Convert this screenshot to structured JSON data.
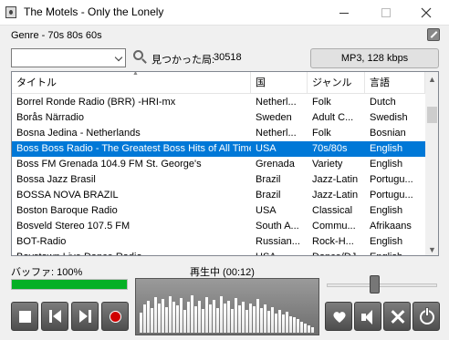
{
  "window": {
    "title": "The Motels - Only the Lonely"
  },
  "genre": {
    "label": "Genre - 70s 80s 60s"
  },
  "search": {
    "dropdown_value": "",
    "found_label": "見つかった局:",
    "found_count": "30518"
  },
  "format_button": {
    "label": "MP3, 128 kbps"
  },
  "table": {
    "columns": [
      "タイトル",
      "国",
      "ジャンル",
      "言語"
    ],
    "rows": [
      {
        "title": "Borrel Ronde Radio (BRR) -HRI-mx",
        "country": "Netherl...",
        "genre": "Folk",
        "language": "Dutch"
      },
      {
        "title": "Borås Närradio",
        "country": "Sweden",
        "genre": "Adult C...",
        "language": "Swedish"
      },
      {
        "title": "Bosna Jedina - Netherlands",
        "country": "Netherl...",
        "genre": "Folk",
        "language": "Bosnian"
      },
      {
        "title": "Boss Boss Radio - The Greatest Boss Hits of All Time",
        "country": "USA",
        "genre": "70s/80s",
        "language": "English",
        "selected": true
      },
      {
        "title": "Boss FM Grenada 104.9 FM St. George's",
        "country": "Grenada",
        "genre": "Variety",
        "language": "English"
      },
      {
        "title": "Bossa Jazz Brasil",
        "country": "Brazil",
        "genre": "Jazz-Latin",
        "language": "Portugu..."
      },
      {
        "title": "BOSSA NOVA BRAZIL",
        "country": "Brazil",
        "genre": "Jazz-Latin",
        "language": "Portugu..."
      },
      {
        "title": "Boston Baroque Radio",
        "country": "USA",
        "genre": "Classical",
        "language": "English"
      },
      {
        "title": "Bosveld Stereo 107.5 FM",
        "country": "South A...",
        "genre": "Commu...",
        "language": "Afrikaans"
      },
      {
        "title": "BOT-Radio",
        "country": "Russian...",
        "genre": "Rock-H...",
        "language": "English"
      },
      {
        "title": "Boystown Live Dance Radio",
        "country": "USA",
        "genre": "Dance/DJ",
        "language": "English"
      }
    ]
  },
  "buffer": {
    "label": "バッファ: 100%",
    "percent": 100
  },
  "status": {
    "label": "再生中 (00:12)"
  },
  "volume": {
    "level": 0.43
  },
  "visualizer": {
    "levels": [
      0.4,
      0.55,
      0.62,
      0.48,
      0.7,
      0.58,
      0.66,
      0.5,
      0.72,
      0.61,
      0.53,
      0.68,
      0.45,
      0.6,
      0.74,
      0.52,
      0.63,
      0.47,
      0.69,
      0.56,
      0.65,
      0.49,
      0.71,
      0.57,
      0.62,
      0.46,
      0.67,
      0.54,
      0.6,
      0.44,
      0.58,
      0.51,
      0.66,
      0.48,
      0.55,
      0.42,
      0.5,
      0.38,
      0.45,
      0.35,
      0.41,
      0.33,
      0.3,
      0.26,
      0.22,
      0.18,
      0.14,
      0.1
    ]
  },
  "colors": {
    "selection": "#0078d7",
    "buffer": "#06b025",
    "record": "#d00000"
  },
  "controls": [
    "stop-icon",
    "previous-icon",
    "next-icon",
    "record-icon",
    "heart-icon",
    "speaker-icon",
    "tools-icon",
    "power-icon"
  ]
}
